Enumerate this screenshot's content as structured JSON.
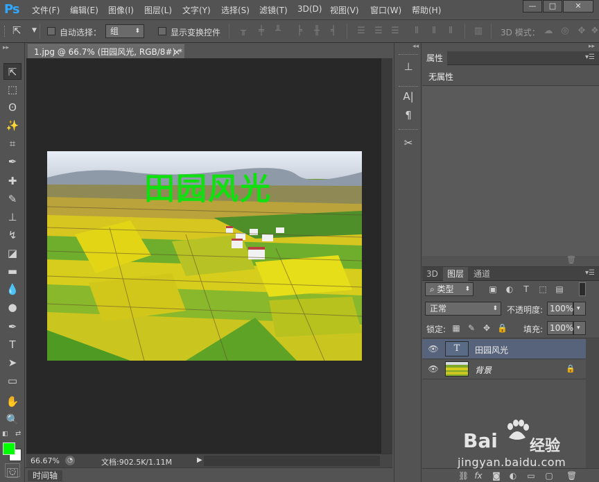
{
  "app": {
    "logo": "Ps"
  },
  "menu": [
    "文件(F)",
    "编辑(E)",
    "图像(I)",
    "图层(L)",
    "文字(Y)",
    "选择(S)",
    "滤镜(T)",
    "3D(D)",
    "视图(V)",
    "窗口(W)",
    "帮助(H)"
  ],
  "window_controls": {
    "minimize": "—",
    "maximize": "□",
    "close": "✕"
  },
  "options": {
    "auto_select_label": "自动选择：",
    "auto_select_value": "组",
    "show_transform_label": "显示变换控件",
    "mode_3d_label": "3D 模式："
  },
  "document": {
    "tab_title": "1.jpg @ 66.7% (田园风光, RGB/8#) *",
    "tab_close": "×",
    "photo_text": "田园风光",
    "zoom": "66.67%",
    "doc_info": "文档:902.5K/1.11M"
  },
  "timeline": {
    "label": "时间轴"
  },
  "properties": {
    "tab": "属性",
    "empty_text": "无属性"
  },
  "layers": {
    "tabs": [
      "3D",
      "图层",
      "通道"
    ],
    "active_tab_index": 1,
    "filter_kind": "类型",
    "blend_mode": "正常",
    "opacity_label": "不透明度:",
    "opacity_value": "100%",
    "lock_label": "锁定:",
    "fill_label": "填充:",
    "fill_value": "100%",
    "items": [
      {
        "name": "田园风光",
        "type": "text",
        "selected": true
      },
      {
        "name": "背景",
        "type": "image",
        "locked": true
      }
    ]
  },
  "colors": {
    "foreground": "#00ff00",
    "background": "#ffffff",
    "ps_blue": "#31a8ff",
    "selected_layer": "#56637a"
  },
  "watermark": {
    "brand": "Bai",
    "brand_cn": "经验",
    "url": "jingyan.baidu.com"
  }
}
